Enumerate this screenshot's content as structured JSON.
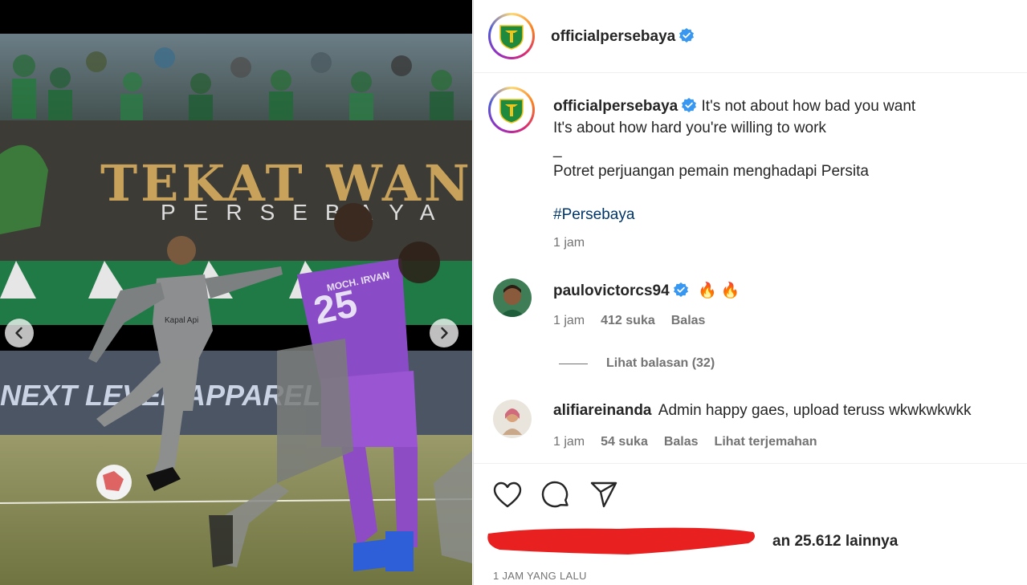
{
  "post": {
    "account": "officialpersebaya",
    "caption_lines": [
      "It's not about how bad you want",
      "It's about how hard you're willing to work",
      "_",
      "Potret perjuangan pemain menghadapi Persita"
    ],
    "hashtag": "#Persebaya",
    "caption_time": "1 jam",
    "photo_text": {
      "banner_main": "TEKAT WANI KU",
      "banner_sub": "PERSEBAYA",
      "ad_board": "NEXT LEVEL APPAREL",
      "jersey_name": "MOCH. IRVAN",
      "jersey_number": "25",
      "shirt_brand": "Kapal Api"
    }
  },
  "comments": [
    {
      "user": "paulovictorcs94",
      "verified": true,
      "text": "🔥 🔥",
      "time": "1 jam",
      "likes": "412 suka",
      "reply": "Balas",
      "view_replies": "Lihat balasan (32)"
    },
    {
      "user": "alifiareinanda",
      "verified": false,
      "text": "Admin happy gaes, upload teruss wkwkwkwkk",
      "time": "1 jam",
      "likes": "54 suka",
      "reply": "Balas",
      "translate": "Lihat terjemahan"
    }
  ],
  "likes_summary": {
    "visible_fragment": "an 25.612 lainnya"
  },
  "time_ago": "1 JAM YANG LALU",
  "icons": {
    "like": "heart-icon",
    "comment": "comment-bubble-icon",
    "share": "paper-plane-icon",
    "prev": "chevron-left-icon",
    "next": "chevron-right-icon",
    "verified": "verified-badge-icon"
  },
  "colors": {
    "verified": "#3897f0",
    "hashtag": "#00376b",
    "muted": "#737373",
    "redaction": "#e8201f"
  }
}
